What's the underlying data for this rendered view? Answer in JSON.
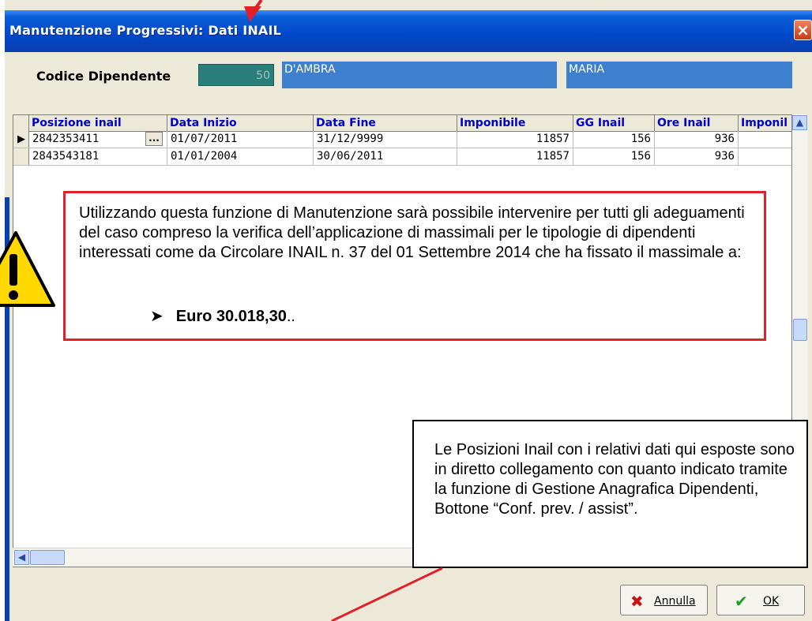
{
  "window": {
    "title": "Manutenzione Progressivi: Dati INAIL",
    "close_label": "×"
  },
  "header": {
    "codice_label": "Codice Dipendente",
    "codice_value": "50",
    "surname": "D'AMBRA",
    "name": "MARIA"
  },
  "grid": {
    "columns": [
      "Posizione inail",
      "Data Inizio",
      "Data Fine",
      "Imponibile",
      "GG Inail",
      "Ore Inail",
      "Imponil"
    ],
    "rows": [
      {
        "posizione": "2842353411",
        "data_inizio": "01/07/2011",
        "data_fine": "31/12/9999",
        "imponibile": "11857",
        "gg": "156",
        "ore": "936"
      },
      {
        "posizione": "2843543181",
        "data_inizio": "01/01/2004",
        "data_fine": "30/06/2011",
        "imponibile": "11857",
        "gg": "156",
        "ore": "936"
      }
    ],
    "ellipsis": "..."
  },
  "buttons": {
    "annulla": "Annulla",
    "ok": "OK"
  },
  "callouts": {
    "red_text": "Utilizzando questa funzione di Manutenzione sarà possibile intervenire per tutti gli adeguamenti del caso compreso la verifica dell’applicazione di massimali per le tipologie di dipendenti interessati come da Circolare INAIL n. 37 del 01 Settembre 2014 che ha fissato il massimale a:",
    "red_bullet": "Euro 30.018,30",
    "red_bullet_suffix": "..",
    "black_text": "Le Posizioni Inail con i relativi dati qui esposte  sono in diretto collegamento con quanto indicato tramite la funzione di Gestione Anagrafica Dipendenti, Bottone “Conf. prev. / assist”."
  },
  "colors": {
    "title_bar": "#0047c9",
    "header_blue": "#3e7fce",
    "code_teal": "#2a7d7a",
    "callout_red": "#e0202a",
    "column_header_text": "#0000c8"
  }
}
